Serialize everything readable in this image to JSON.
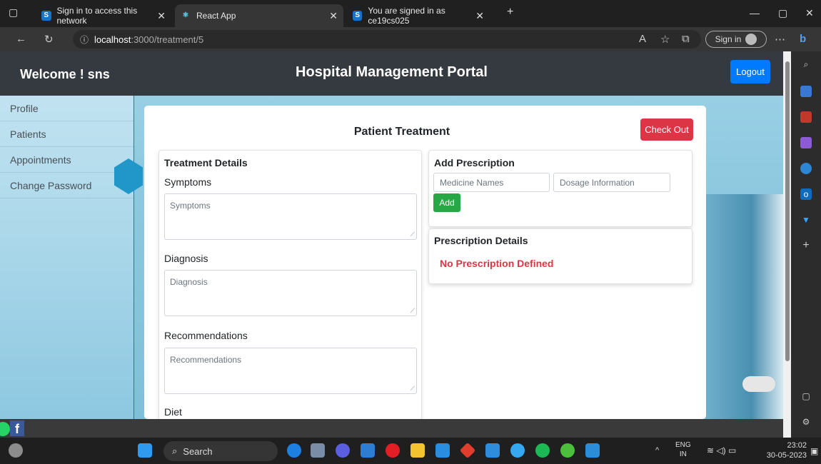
{
  "browser": {
    "tabs": [
      {
        "title": "Sign in to access this network"
      },
      {
        "title": "React App"
      },
      {
        "title": "You are signed in as ce19cs025"
      }
    ],
    "url_host": "localhost",
    "url_path": ":3000/treatment/5",
    "signin_label": "Sign in"
  },
  "header": {
    "welcome": "Welcome ! sns",
    "title": "Hospital Management Portal",
    "logout_label": "Logout"
  },
  "sidebar": {
    "items": [
      {
        "label": "Profile"
      },
      {
        "label": "Patients"
      },
      {
        "label": "Appointments"
      },
      {
        "label": "Change Password"
      }
    ]
  },
  "treatment": {
    "title": "Patient Treatment",
    "checkout_label": "Check Out",
    "details_heading": "Treatment Details",
    "symptoms_label": "Symptoms",
    "symptoms_placeholder": "Symptoms",
    "diagnosis_label": "Diagnosis",
    "diagnosis_placeholder": "Diagnosis",
    "recommendations_label": "Recommendations",
    "recommendations_placeholder": "Recommendations",
    "diet_label": "Diet"
  },
  "prescription": {
    "heading": "Add Prescription",
    "medicine_placeholder": "Medicine Names",
    "dosage_placeholder": "Dosage Information",
    "add_label": "Add",
    "details_heading": "Prescription Details",
    "empty_message": "No Prescription Defined"
  },
  "taskbar": {
    "search_label": "Search",
    "lang_line1": "ENG",
    "lang_line2": "IN",
    "time": "23:02",
    "date": "30-05-2023"
  },
  "colors": {
    "header_bg": "#343a40",
    "primary": "#007bff",
    "danger": "#dc3545",
    "success": "#28a745"
  }
}
